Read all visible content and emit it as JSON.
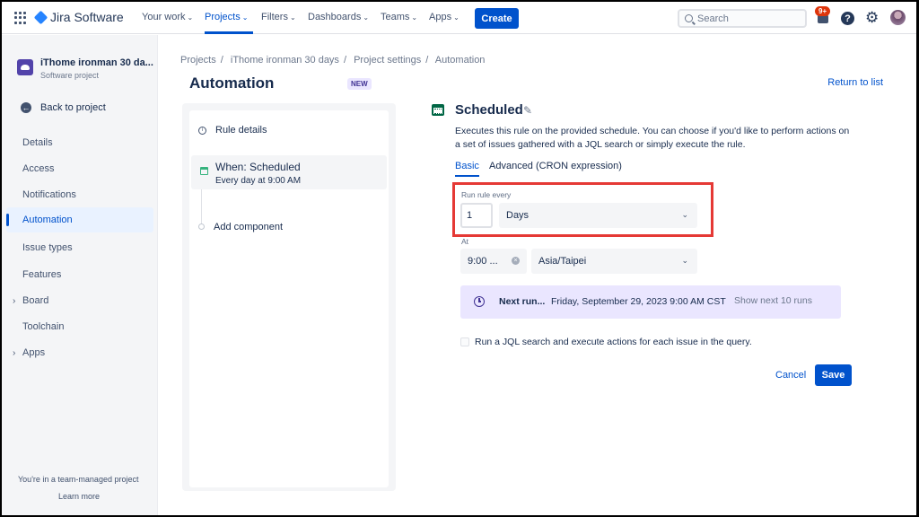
{
  "topnav": {
    "product": "Jira Software",
    "items": [
      {
        "label": "Your work",
        "active": false
      },
      {
        "label": "Projects",
        "active": true
      },
      {
        "label": "Filters",
        "active": false
      },
      {
        "label": "Dashboards",
        "active": false
      },
      {
        "label": "Teams",
        "active": false
      },
      {
        "label": "Apps",
        "active": false
      }
    ],
    "create_label": "Create",
    "search_placeholder": "Search",
    "notification_badge": "9+",
    "help_glyph": "?",
    "gear_glyph": "⚙",
    "chevron": "⌄",
    "icons": [
      "app-switcher-icon",
      "jira-logo-icon",
      "search-icon",
      "notification-bell-icon",
      "help-icon",
      "settings-gear-icon",
      "user-avatar"
    ]
  },
  "sidebar": {
    "project_name": "iThome ironman 30 da...",
    "project_type": "Software project",
    "back_label": "Back to project",
    "back_glyph": "←",
    "items": [
      {
        "label": "Details"
      },
      {
        "label": "Access"
      },
      {
        "label": "Notifications"
      },
      {
        "label": "Automation",
        "active": true
      },
      {
        "label": "Issue types"
      },
      {
        "label": "Features"
      },
      {
        "label": "Board",
        "expandable": true
      },
      {
        "label": "Toolchain"
      },
      {
        "label": "Apps",
        "expandable": true
      }
    ],
    "caret_glyph": "›",
    "footer_text": "You're in a team-managed project",
    "footer_link": "Learn more"
  },
  "breadcrumb": {
    "items": [
      "Projects",
      "iThome ironman 30 days",
      "Project settings",
      "Automation"
    ],
    "separator": "/"
  },
  "page": {
    "title": "Automation",
    "lozenge": "NEW",
    "return_link": "Return to list"
  },
  "rule_panel": {
    "details_label": "Rule details",
    "info_glyph": "i",
    "trigger_title": "When: Scheduled",
    "trigger_subtitle": "Every day at 9:00 AM",
    "add_component": "Add component"
  },
  "config": {
    "title": "Scheduled",
    "pencil_glyph": "✎",
    "description": "Executes this rule on the provided schedule. You can choose if you'd like to perform actions on a set of issues gathered with a JQL search or simply execute the rule.",
    "tabs": [
      {
        "label": "Basic",
        "active": true
      },
      {
        "label": "Advanced (CRON expression)",
        "active": false
      }
    ],
    "run_every_label": "Run rule every",
    "run_every_value": "1",
    "run_every_unit": "Days",
    "at_label": "At",
    "time_value": "9:00 ...",
    "clear_glyph": "×",
    "timezone": "Asia/Taipei",
    "dropdown_glyph": "⌄",
    "next_run_label": "Next run...",
    "next_run_date": "Friday, September 29, 2023 9:00 AM CST",
    "show_next": "Show next 10 runs",
    "jql_checkbox_label": "Run a JQL search and execute actions for each issue in the query.",
    "jql_checked": false,
    "cancel_label": "Cancel",
    "save_label": "Save"
  },
  "colors": {
    "brand_blue": "#0052CC",
    "highlight_red": "#E53935",
    "next_run_bg": "#EAE6FF",
    "badge_red": "#DE350B"
  }
}
